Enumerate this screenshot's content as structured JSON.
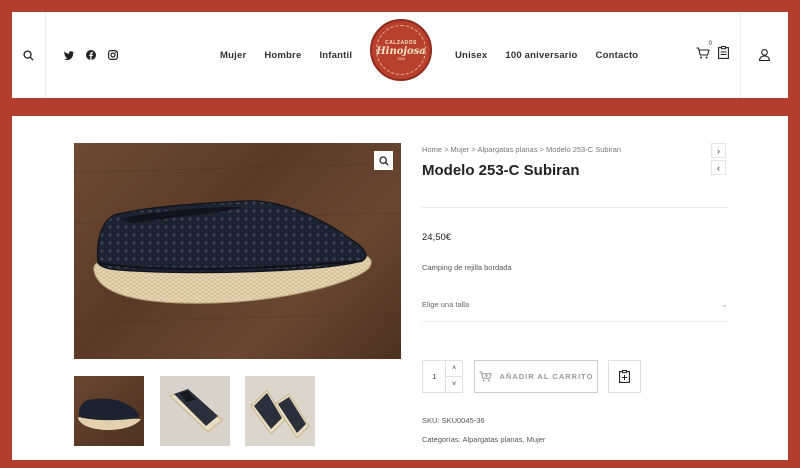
{
  "header": {
    "nav_left": [
      "Mujer",
      "Hombre",
      "Infantil"
    ],
    "nav_right": [
      "Unisex",
      "100 aniversario",
      "Contacto"
    ],
    "logo": {
      "top_text": "CALZADOS",
      "brand": "Hinojosa",
      "bottom_text": "1926"
    },
    "cart_count": "0",
    "icons": {
      "search": "search-icon",
      "social": [
        "twitter-icon",
        "facebook-icon",
        "instagram-icon"
      ],
      "cart": "cart-icon",
      "wishlist": "wishlist-icon",
      "user": "user-icon"
    }
  },
  "product": {
    "breadcrumb": "Home > Mujer > Alpargatas planas > Modelo 253-C Subiran",
    "title": "Modelo 253-C Subiran",
    "price": "24,50€",
    "description": "Camping de rejilla bordada",
    "size_placeholder": "Elige una talla",
    "quantity": "1",
    "add_to_cart_label": "AÑADIR AL CARRITO",
    "sku": "SKU: SKU0045-36",
    "categories": "Categorías: Alpargatas planas, Mujer"
  },
  "colors": {
    "brand_red": "#b23e2e",
    "text": "#333333"
  }
}
